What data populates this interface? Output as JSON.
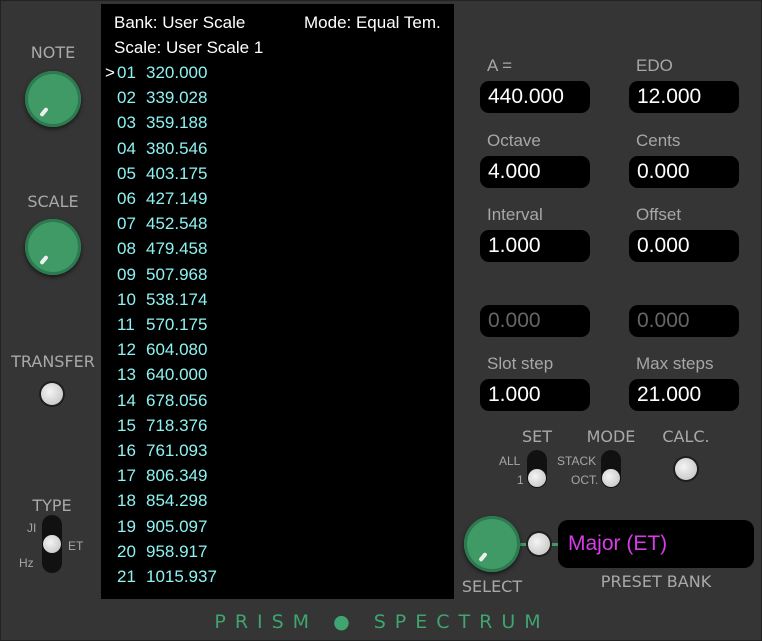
{
  "left": {
    "note_label": "NOTE",
    "scale_label": "SCALE",
    "transfer_label": "TRANSFER",
    "type_label": "TYPE",
    "type_ji": "JI",
    "type_et": "ET",
    "type_hz": "Hz"
  },
  "screen": {
    "bank": "Bank: User Scale",
    "mode": "Mode: Equal Tem.",
    "scale": "Scale: User Scale 1",
    "marker": ">",
    "rows": [
      {
        "n": "01",
        "v": "320.000"
      },
      {
        "n": "02",
        "v": "339.028"
      },
      {
        "n": "03",
        "v": "359.188"
      },
      {
        "n": "04",
        "v": "380.546"
      },
      {
        "n": "05",
        "v": "403.175"
      },
      {
        "n": "06",
        "v": "427.149"
      },
      {
        "n": "07",
        "v": "452.548"
      },
      {
        "n": "08",
        "v": "479.458"
      },
      {
        "n": "09",
        "v": "507.968"
      },
      {
        "n": "10",
        "v": "538.174"
      },
      {
        "n": "11",
        "v": "570.175"
      },
      {
        "n": "12",
        "v": "604.080"
      },
      {
        "n": "13",
        "v": "640.000"
      },
      {
        "n": "14",
        "v": "678.056"
      },
      {
        "n": "15",
        "v": "718.376"
      },
      {
        "n": "16",
        "v": "761.093"
      },
      {
        "n": "17",
        "v": "806.349"
      },
      {
        "n": "18",
        "v": "854.298"
      },
      {
        "n": "19",
        "v": "905.097"
      },
      {
        "n": "20",
        "v": "958.917"
      },
      {
        "n": "21",
        "v": "1015.937"
      }
    ]
  },
  "fields": {
    "a_label": "A =",
    "a_value": "440.000",
    "edo_label": "EDO",
    "edo_value": "12.000",
    "octave_label": "Octave",
    "octave_value": "4.000",
    "cents_label": "Cents",
    "cents_value": "0.000",
    "interval_label": "Interval",
    "interval_value": "1.000",
    "offset_label": "Offset",
    "offset_value": "0.000",
    "blank1_value": "0.000",
    "blank2_value": "0.000",
    "slotstep_label": "Slot step",
    "slotstep_value": "1.000",
    "maxsteps_label": "Max steps",
    "maxsteps_value": "21.000"
  },
  "controls": {
    "set_label": "SET",
    "set_all": "ALL",
    "set_one": "1",
    "mode_label": "MODE",
    "mode_stack": "STACK",
    "mode_oct": "OCT.",
    "calc_label": "CALC.",
    "select_label": "SELECT",
    "preset_value": "Major (ET)",
    "preset_bank_label": "PRESET BANK"
  },
  "footer": {
    "brand": "PRISM ● SPECTRUM"
  },
  "colors": {
    "accent_green": "#3f9a66",
    "preset_magenta": "#d63de6",
    "list_cyan": "#8ff2f2"
  }
}
